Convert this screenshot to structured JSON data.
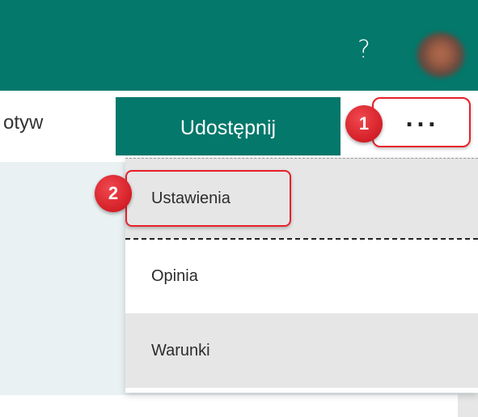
{
  "header": {
    "help_label": "?",
    "avatar_icon": "user-avatar",
    "background_color": "#03786b"
  },
  "toolbar": {
    "partial_label": "otyw",
    "share_label": "Udostępnij",
    "more_label": "...",
    "more_icon": "ellipsis-icon"
  },
  "menu": {
    "items": [
      {
        "label": "Ustawienia"
      },
      {
        "label": "Opinia"
      },
      {
        "label": "Warunki"
      }
    ]
  },
  "annotations": {
    "step1": "1",
    "step2": "2",
    "highlight_color": "#e8202a"
  }
}
